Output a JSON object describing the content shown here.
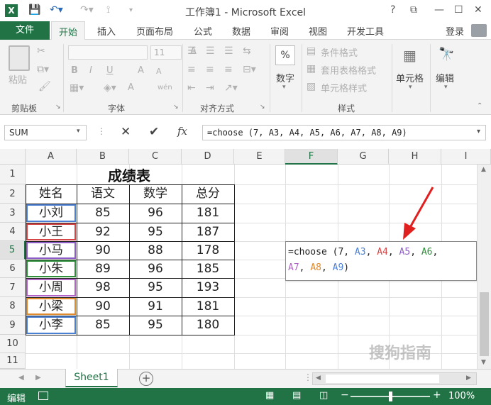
{
  "app": {
    "title": "工作簿1 - Microsoft Excel",
    "logo": "X",
    "help": "?",
    "restore": "⧉",
    "minimize": "—",
    "maximize": "☐",
    "close": "✕"
  },
  "tabs": [
    "文件",
    "开始",
    "插入",
    "页面布局",
    "公式",
    "数据",
    "审阅",
    "视图",
    "开发工具"
  ],
  "login": "登录",
  "ribbon": {
    "clipboard": {
      "paste": "粘贴",
      "label": "剪贴板"
    },
    "font": {
      "size": "11",
      "label": "字体",
      "bold": "B",
      "italic": "I",
      "underline": "U",
      "grow": "A",
      "shrink": "A",
      "color": "A",
      "phonetic": "wén"
    },
    "alignment": {
      "label": "对齐方式"
    },
    "number": {
      "title": "数字",
      "icon": "%"
    },
    "styles": {
      "label": "样式",
      "conditional": "条件格式",
      "table": "套用表格格式",
      "cell": "单元格样式"
    },
    "cells": {
      "title": "单元格"
    },
    "editing": {
      "title": "编辑"
    }
  },
  "formula_bar": {
    "namebox": "SUM",
    "cancel": "✕",
    "enter": "✔",
    "fx": "fx",
    "formula": "=choose (7, A3, A4, A5, A6, A7, A8, A9)"
  },
  "columns": [
    "A",
    "B",
    "C",
    "D",
    "E",
    "F",
    "G",
    "H",
    "I"
  ],
  "rows": [
    "1",
    "2",
    "3",
    "4",
    "5",
    "6",
    "7",
    "8",
    "9",
    "10",
    "11"
  ],
  "sheet_title": "成绩表",
  "headers": [
    "姓名",
    "语文",
    "数学",
    "总分"
  ],
  "data": [
    [
      "小刘",
      "85",
      "96",
      "181"
    ],
    [
      "小王",
      "92",
      "95",
      "187"
    ],
    [
      "小马",
      "90",
      "88",
      "178"
    ],
    [
      "小朱",
      "89",
      "96",
      "185"
    ],
    [
      "小周",
      "98",
      "95",
      "193"
    ],
    [
      "小梁",
      "90",
      "91",
      "181"
    ],
    [
      "小李",
      "85",
      "95",
      "180"
    ]
  ],
  "edit_cell": {
    "line1": [
      {
        "t": "=choose (7, ",
        "c": "#222222"
      },
      {
        "t": "A3",
        "c": "#4a7fd4"
      },
      {
        "t": ", ",
        "c": "#222222"
      },
      {
        "t": "A4",
        "c": "#d64545"
      },
      {
        "t": ", ",
        "c": "#222222"
      },
      {
        "t": "A5",
        "c": "#8e5cc7"
      },
      {
        "t": ", ",
        "c": "#222222"
      },
      {
        "t": "A6",
        "c": "#2f8f3a"
      },
      {
        "t": ",",
        "c": "#222222"
      }
    ],
    "line2": [
      {
        "t": "A7",
        "c": "#b264c6"
      },
      {
        "t": ", ",
        "c": "#222222"
      },
      {
        "t": "A8",
        "c": "#e08a2e"
      },
      {
        "t": ", ",
        "c": "#222222"
      },
      {
        "t": "A9",
        "c": "#4a7fd4"
      },
      {
        "t": ")",
        "c": "#222222"
      }
    ]
  },
  "ref_colors": [
    "#4a7fd4",
    "#d64545",
    "#8e5cc7",
    "#2f8f3a",
    "#b264c6",
    "#e08a2e",
    "#4a7fd4"
  ],
  "sheet_tab": "Sheet1",
  "status": {
    "mode": "编辑",
    "zoom": "100%"
  },
  "watermark": "搜狗指南",
  "accent": "#217346"
}
